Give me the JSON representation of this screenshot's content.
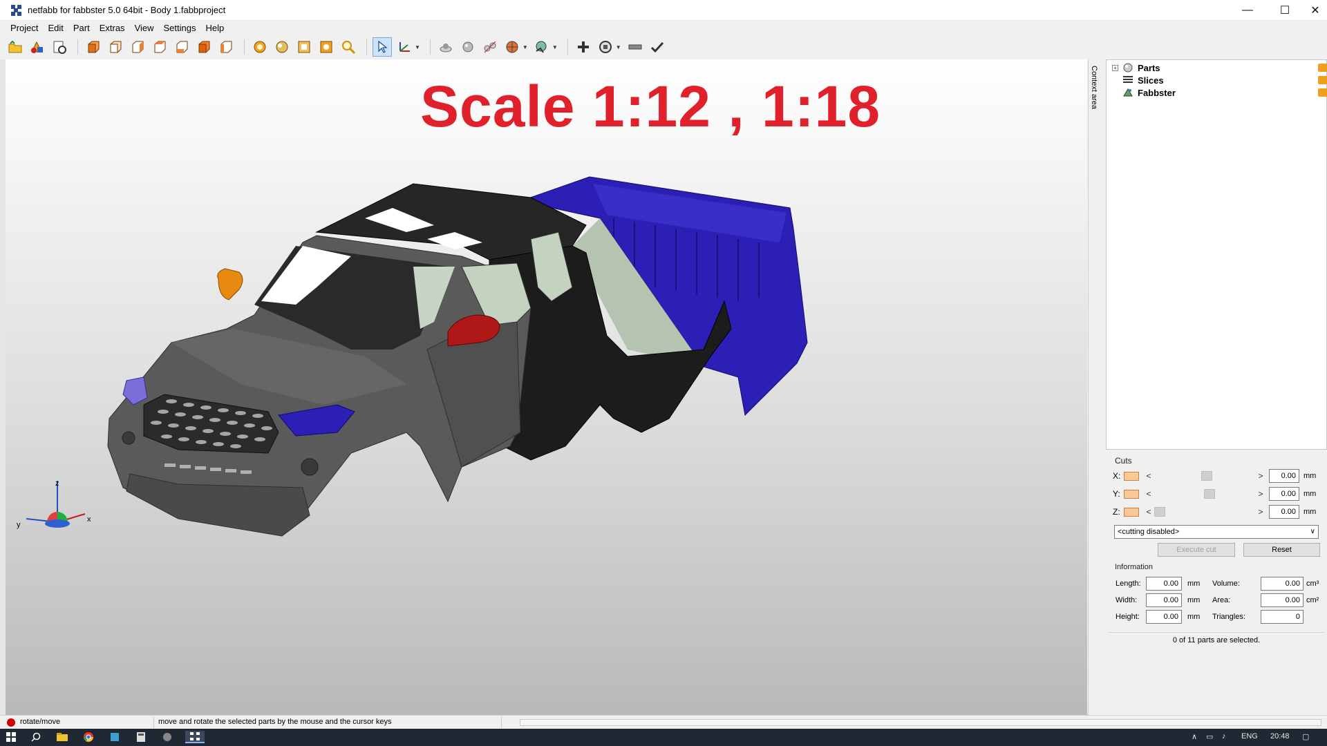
{
  "window": {
    "title": "netfabb for fabbster 5.0 64bit - Body 1.fabbproject",
    "minimize_glyph": "—",
    "maximize_glyph": "☐",
    "close_glyph": "✕"
  },
  "menu": [
    "Project",
    "Edit",
    "Part",
    "Extras",
    "View",
    "Settings",
    "Help"
  ],
  "toolbar_icons": [
    "open-project-icon",
    "add-part-icon",
    "project-info-icon",
    "view-front-icon",
    "view-back-icon",
    "view-left-icon",
    "view-right-icon",
    "view-top-icon",
    "view-bottom-icon",
    "view-iso-icon",
    "zoom-selection-icon",
    "zoom-all-icon",
    "zoom-platform-icon",
    "zoom-window-icon",
    "magnifier-icon",
    "select-pointer-icon",
    "move-axis-icon",
    "shading-icon",
    "sphere-icon",
    "measure-icon",
    "color-wheel-icon",
    "view-mode-icon",
    "add-icon",
    "repair-icon",
    "ruler-icon",
    "check-icon"
  ],
  "viewport": {
    "overlay_text": "Scale 1:12 , 1:18",
    "axes": {
      "z": "z",
      "x": "x",
      "y": "y"
    }
  },
  "context_area_label": "Context area",
  "tree": [
    {
      "label": "Parts",
      "icon": "parts-icon",
      "expandable": true
    },
    {
      "label": "Slices",
      "icon": "slices-icon",
      "expandable": false
    },
    {
      "label": "Fabbster",
      "icon": "fabbster-icon",
      "expandable": false
    }
  ],
  "cuts": {
    "title": "Cuts",
    "rows": [
      {
        "axis": "X:",
        "value": "0.00",
        "unit": "mm",
        "slider": 0.48
      },
      {
        "axis": "Y:",
        "value": "0.00",
        "unit": "mm",
        "slider": 0.5
      },
      {
        "axis": "Z:",
        "value": "0.00",
        "unit": "mm",
        "slider": 0.02
      }
    ],
    "mode_select": "<cutting disabled>",
    "execute_label": "Execute cut",
    "reset_label": "Reset"
  },
  "information": {
    "title": "Information",
    "length_label": "Length:",
    "length_value": "0.00",
    "width_label": "Width:",
    "width_value": "0.00",
    "height_label": "Height:",
    "height_value": "0.00",
    "volume_label": "Volume:",
    "volume_value": "0.00",
    "area_label": "Area:",
    "area_value": "0.00",
    "triangles_label": "Triangles:",
    "triangles_value": "0",
    "mm": "mm",
    "cm3": "cm³",
    "cm2": "cm²"
  },
  "selection_status": "0 of 11 parts are selected.",
  "statusbar": {
    "mode": "rotate/move",
    "hint": "move and rotate the selected parts by the mouse and the cursor keys"
  },
  "taskbar": {
    "language": "ENG",
    "time": "20:48"
  },
  "colors": {
    "overlay_text": "#e0202a",
    "body_gray": "#5a5a5a",
    "bed_blue": "#2a1fb0",
    "mirror_orange": "#e88a10",
    "mirror_red": "#b01818",
    "light_purple": "#7a6ed8"
  }
}
